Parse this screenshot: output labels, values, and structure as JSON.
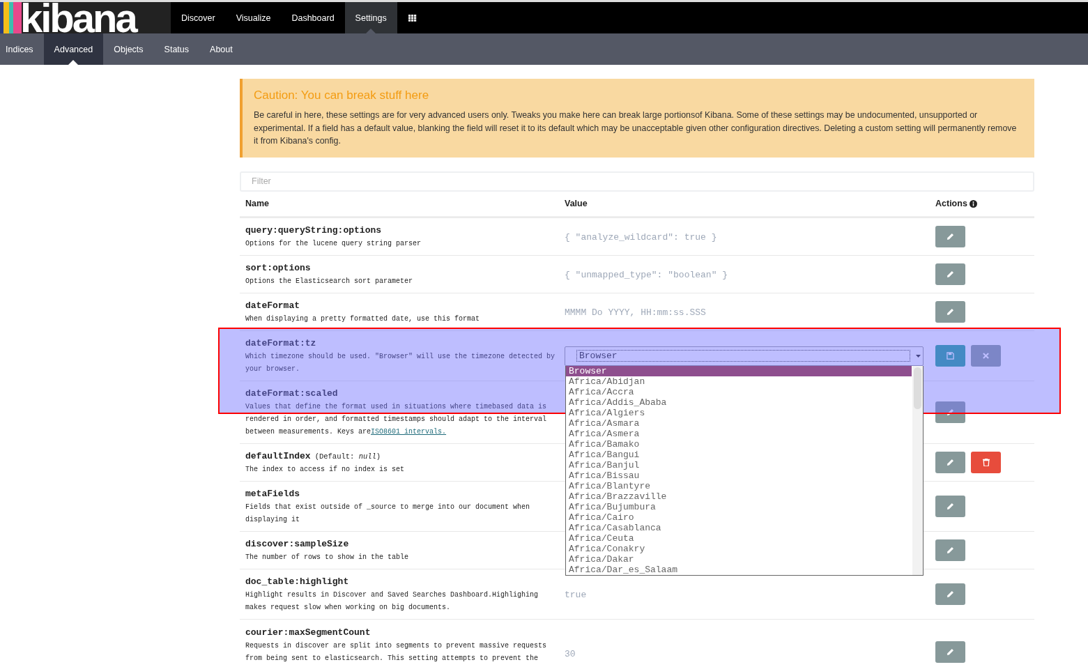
{
  "logo": {
    "text": "kibana"
  },
  "main_tabs": [
    {
      "label": "Discover",
      "selected": false
    },
    {
      "label": "Visualize",
      "selected": false
    },
    {
      "label": "Dashboard",
      "selected": false
    },
    {
      "label": "Settings",
      "selected": true
    }
  ],
  "sub_tabs": [
    {
      "label": "Indices",
      "selected": false
    },
    {
      "label": "Advanced",
      "selected": true
    },
    {
      "label": "Objects",
      "selected": false
    },
    {
      "label": "Status",
      "selected": false
    },
    {
      "label": "About",
      "selected": false
    }
  ],
  "caution": {
    "title": "Caution: You can break stuff here",
    "text": "Be careful in here, these settings are for very advanced users only. Tweaks you make here can break large portionsof Kibana. Some of these settings may be undocumented, unsupported or experimental. If a field has a default value, blanking the field will reset it to its default which may be unacceptable given other configuration directives. Deleting a custom setting will permanently remove it from Kibana's config."
  },
  "filter": {
    "placeholder": "Filter"
  },
  "columns": [
    "Name",
    "Value",
    "Actions"
  ],
  "rows": [
    {
      "name": "query:queryString:options",
      "description": "Options for the lucene query string parser",
      "value": "{ \"analyze_wildcard\": true }",
      "editing": false,
      "deletable": false
    },
    {
      "name": "sort:options",
      "description": "Options the Elasticsearch sort parameter",
      "value": "{ \"unmapped_type\": \"boolean\" }",
      "editing": false,
      "deletable": false
    },
    {
      "name": "dateFormat",
      "description": "When displaying a pretty formatted date, use this format",
      "value": "MMMM Do YYYY, HH:mm:ss.SSS",
      "editing": false,
      "deletable": false
    },
    {
      "name": "dateFormat:tz",
      "description": "Which timezone should be used. \"Browser\" will use the timezone detected by your browser.",
      "editing": true,
      "deletable": false,
      "select": {
        "value": "Browser",
        "options": [
          {
            "label": "Browser",
            "selected": true
          },
          {
            "label": "Africa/Abidjan",
            "selected": false
          },
          {
            "label": "Africa/Accra",
            "selected": false
          },
          {
            "label": "Africa/Addis_Ababa",
            "selected": false
          },
          {
            "label": "Africa/Algiers",
            "selected": false
          },
          {
            "label": "Africa/Asmara",
            "selected": false
          },
          {
            "label": "Africa/Asmera",
            "selected": false
          },
          {
            "label": "Africa/Bamako",
            "selected": false
          },
          {
            "label": "Africa/Bangui",
            "selected": false
          },
          {
            "label": "Africa/Banjul",
            "selected": false
          },
          {
            "label": "Africa/Bissau",
            "selected": false
          },
          {
            "label": "Africa/Blantyre",
            "selected": false
          },
          {
            "label": "Africa/Brazzaville",
            "selected": false
          },
          {
            "label": "Africa/Bujumbura",
            "selected": false
          },
          {
            "label": "Africa/Cairo",
            "selected": false
          },
          {
            "label": "Africa/Casablanca",
            "selected": false
          },
          {
            "label": "Africa/Ceuta",
            "selected": false
          },
          {
            "label": "Africa/Conakry",
            "selected": false
          },
          {
            "label": "Africa/Dakar",
            "selected": false
          },
          {
            "label": "Africa/Dar_es_Salaam",
            "selected": false
          }
        ]
      }
    },
    {
      "name": "dateFormat:scaled",
      "description": "Values that define the format used in situations where timebased data is rendered in order, and formatted timestamps should adapt to the interval between measurements. Keys are",
      "link": "ISO8601 intervals.",
      "editing": false,
      "deletable": false
    },
    {
      "name": "defaultIndex",
      "default_note": "(Default: *null*)",
      "description": "The index to access if no index is set",
      "editing": false,
      "deletable": true
    },
    {
      "name": "metaFields",
      "description": "Fields that exist outside of _source to merge into our document when displaying it",
      "editing": false,
      "deletable": false
    },
    {
      "name": "discover:sampleSize",
      "description": "The number of rows to show in the table",
      "editing": false,
      "deletable": false
    },
    {
      "name": "doc_table:highlight",
      "description": "Highlight results in Discover and Saved Searches Dashboard.Highlighing makes request slow when working on big documents.",
      "value": "true",
      "editing": false,
      "deletable": false
    },
    {
      "name": "courier:maxSegmentCount",
      "description": "Requests in discover are split into segments to prevent massive requests from being sent to elasticsearch. This setting attempts to prevent the",
      "value": "30",
      "editing": false,
      "deletable": false
    }
  ]
}
